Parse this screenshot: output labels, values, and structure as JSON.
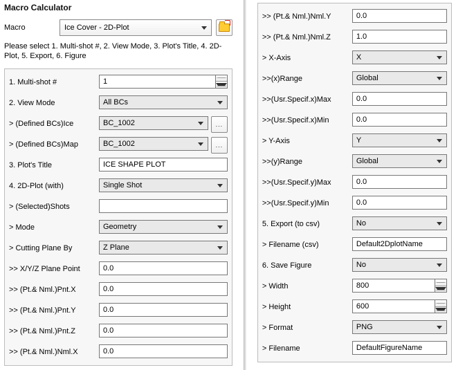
{
  "header": {
    "title": "Macro Calculator",
    "macroLabel": "Macro",
    "macroValue": "Ice Cover - 2D-Plot",
    "description": "Please select 1. Multi-shot #, 2. View Mode, 3. Plot's Title, 4. 2D-Plot, 5. Export, 6. Figure"
  },
  "left": {
    "multiShot": {
      "label": "1. Multi-shot #",
      "value": "1"
    },
    "viewMode": {
      "label": "2. View Mode",
      "value": "All BCs"
    },
    "defBCsIce": {
      "label": "> (Defined BCs)Ice",
      "value": "BC_1002",
      "btn": "..."
    },
    "defBCsMap": {
      "label": "> (Defined BCs)Map",
      "value": "BC_1002",
      "btn": "..."
    },
    "plotTitle": {
      "label": "3. Plot's Title",
      "value": "ICE SHAPE PLOT"
    },
    "plot2d": {
      "label": "4. 2D-Plot (with)",
      "value": "Single Shot"
    },
    "selShots": {
      "label": "> (Selected)Shots",
      "value": ""
    },
    "mode": {
      "label": "> Mode",
      "value": "Geometry"
    },
    "cutPlane": {
      "label": "> Cutting Plane By",
      "value": "Z Plane"
    },
    "xyzPt": {
      "label": ">> X/Y/Z Plane Point",
      "value": "0.0"
    },
    "pntX": {
      "label": ">> (Pt.& Nml.)Pnt.X",
      "value": "0.0"
    },
    "pntY": {
      "label": ">> (Pt.& Nml.)Pnt.Y",
      "value": "0.0"
    },
    "pntZ": {
      "label": ">> (Pt.& Nml.)Pnt.Z",
      "value": "0.0"
    },
    "nmlX": {
      "label": ">> (Pt.& Nml.)Nml.X",
      "value": "0.0"
    }
  },
  "right": {
    "nmlY": {
      "label": ">> (Pt.& Nml.)Nml.Y",
      "value": "0.0"
    },
    "nmlZ": {
      "label": ">> (Pt.& Nml.)Nml.Z",
      "value": "1.0"
    },
    "xAxis": {
      "label": "> X-Axis",
      "value": "X"
    },
    "xRange": {
      "label": ">>(x)Range",
      "value": "Global"
    },
    "usrXMax": {
      "label": ">>(Usr.Specif.x)Max",
      "value": "0.0"
    },
    "usrXMin": {
      "label": ">>(Usr.Specif.x)Min",
      "value": "0.0"
    },
    "yAxis": {
      "label": "> Y-Axis",
      "value": "Y"
    },
    "yRange": {
      "label": ">>(y)Range",
      "value": "Global"
    },
    "usrYMax": {
      "label": ">>(Usr.Specif.y)Max",
      "value": "0.0"
    },
    "usrYMin": {
      "label": ">>(Usr.Specif.y)Min",
      "value": "0.0"
    },
    "exportCsv": {
      "label": "5. Export (to csv)",
      "value": "No"
    },
    "fnameCsv": {
      "label": "> Filename (csv)",
      "value": "Default2DplotName"
    },
    "saveFig": {
      "label": "6. Save Figure",
      "value": "No"
    },
    "width": {
      "label": "> Width",
      "value": "800"
    },
    "height": {
      "label": "> Height",
      "value": "600"
    },
    "format": {
      "label": "> Format",
      "value": "PNG"
    },
    "fname": {
      "label": "> Filename",
      "value": "DefaultFigureName"
    }
  }
}
